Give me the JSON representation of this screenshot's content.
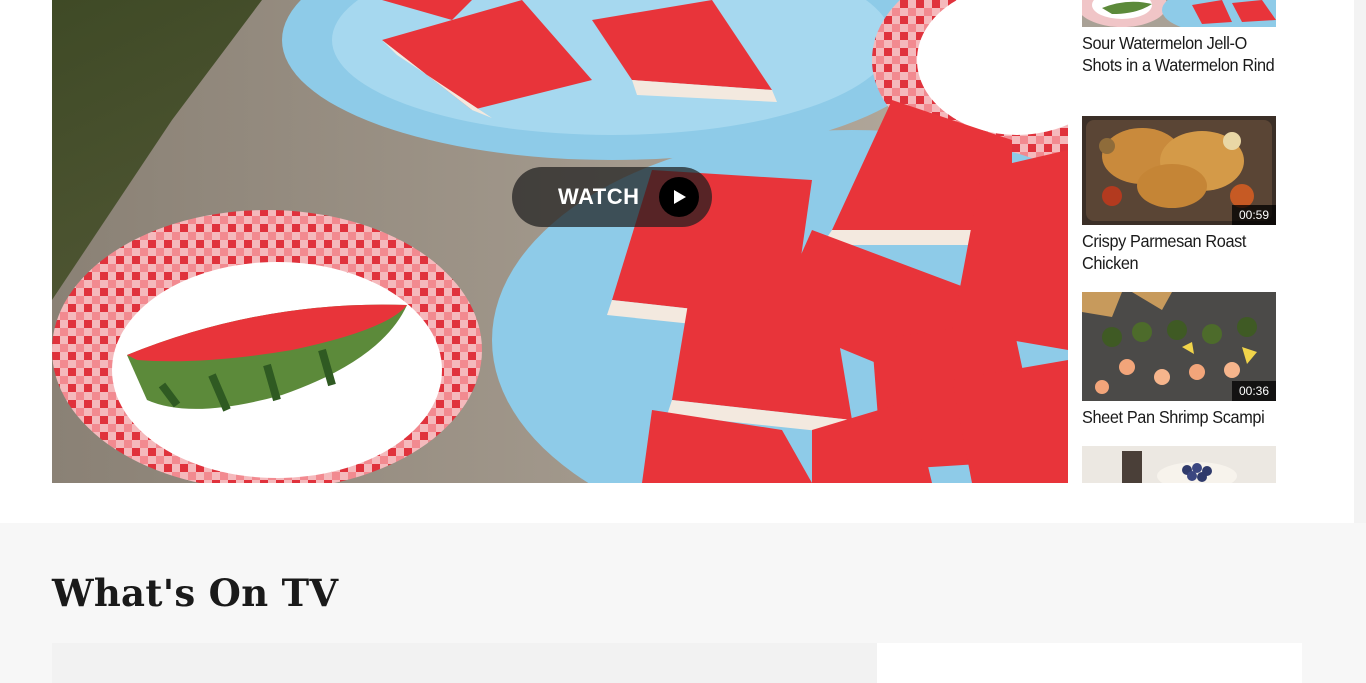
{
  "video_player": {
    "watch_label": "WATCH",
    "play_icon": "play-icon"
  },
  "playlist": {
    "items": [
      {
        "title": "Sour Watermelon Jell-O Shots in a Watermelon Rind",
        "duration": ""
      },
      {
        "title": "Crispy Parmesan Roast Chicken",
        "duration": "00:59"
      },
      {
        "title": "Sheet Pan Shrimp Scampi",
        "duration": "00:36"
      },
      {
        "title": "",
        "duration": ""
      }
    ]
  },
  "tv_section": {
    "heading": "What's On TV"
  },
  "colors": {
    "plate_blue": "#8ecbe8",
    "jello_red": "#e8343a",
    "checker_red": "#e0323c",
    "rind_green": "#5c8a3a",
    "overlay": "#1e1e1e",
    "text": "#1a1a1a"
  }
}
